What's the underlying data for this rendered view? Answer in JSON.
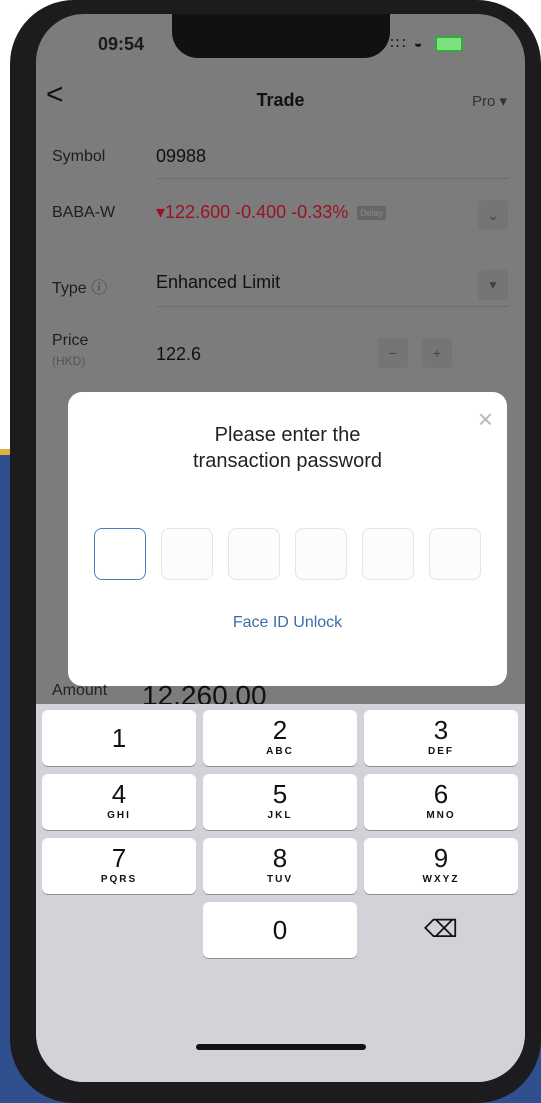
{
  "status": {
    "time": "09:54",
    "signal": "∶∷",
    "wifi": "◒"
  },
  "nav": {
    "back": "<",
    "title": "Trade",
    "mode": "Pro ▾"
  },
  "symbol": {
    "label": "Symbol",
    "value": "09988"
  },
  "quote": {
    "label": "BABA-W",
    "price": "▾122.600",
    "change": "-0.400",
    "change_pct": "-0.33%",
    "delay_badge": "Delay",
    "color": "#9b1323"
  },
  "type": {
    "label": "Type",
    "info_icon": "ⓘ",
    "value": "Enhanced Limit"
  },
  "price": {
    "label": "Price",
    "unit": "(HKD)",
    "value": "122.6",
    "minus": "−",
    "plus": "+"
  },
  "dialog": {
    "title_line1": "Please enter the",
    "title_line2": "transaction password",
    "close": "×",
    "face_id": "Face ID Unlock"
  },
  "amount": {
    "label": "Amount",
    "value": "12,260.00"
  },
  "keypad": {
    "k1": {
      "digit": "1",
      "letters": ""
    },
    "k2": {
      "digit": "2",
      "letters": "ABC"
    },
    "k3": {
      "digit": "3",
      "letters": "DEF"
    },
    "k4": {
      "digit": "4",
      "letters": "GHI"
    },
    "k5": {
      "digit": "5",
      "letters": "JKL"
    },
    "k6": {
      "digit": "6",
      "letters": "MNO"
    },
    "k7": {
      "digit": "7",
      "letters": "PQRS"
    },
    "k8": {
      "digit": "8",
      "letters": "TUV"
    },
    "k9": {
      "digit": "9",
      "letters": "WXYZ"
    },
    "k0": {
      "digit": "0",
      "letters": ""
    },
    "backspace": "⌫"
  }
}
